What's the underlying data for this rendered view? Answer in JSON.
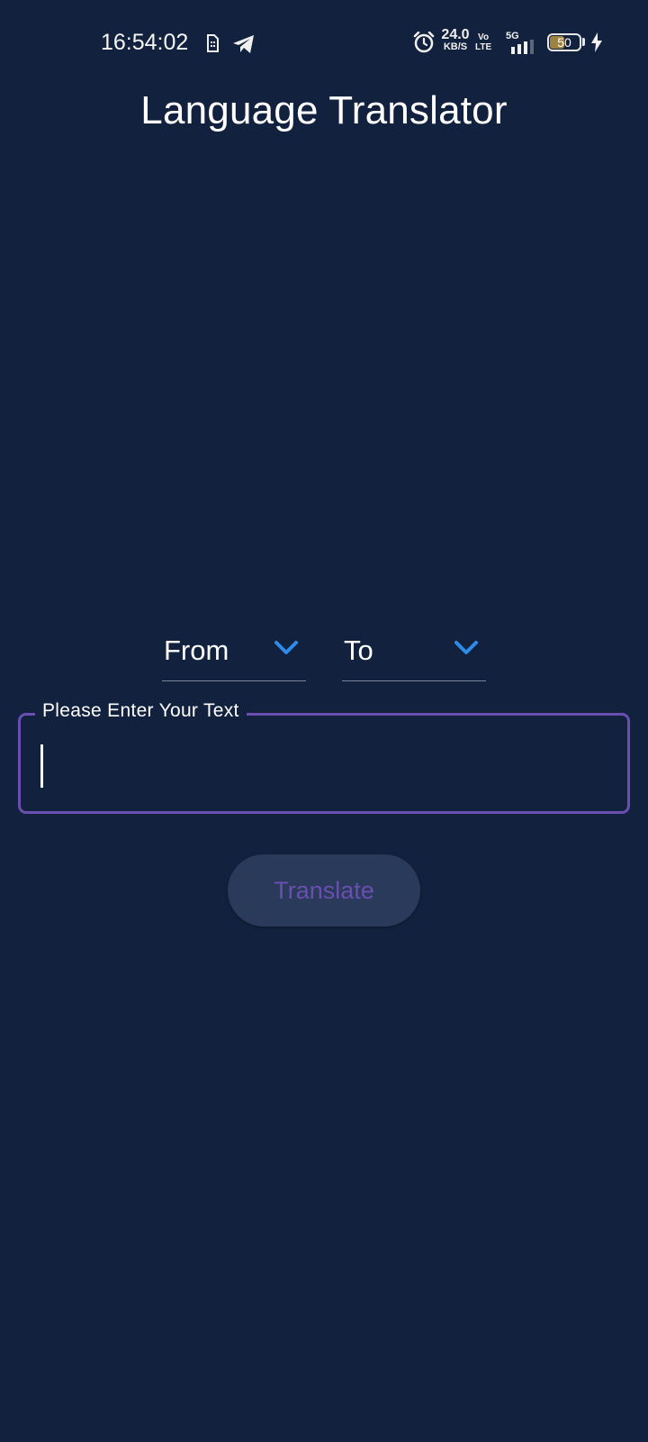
{
  "status_bar": {
    "time": "16:54:02",
    "speed_value": "24.0",
    "speed_unit": "KB/S",
    "volte_top": "Vo",
    "volte_bottom": "LTE",
    "network": "5G",
    "battery_level": "50",
    "battery_fraction": 0.5,
    "icons": [
      "sim-card-icon",
      "telegram-icon",
      "alarm-icon",
      "signal-icon",
      "battery-icon",
      "charging-icon"
    ]
  },
  "app": {
    "title": "Language Translator"
  },
  "dropdowns": {
    "from_label": "From",
    "to_label": "To"
  },
  "input": {
    "label": "Please Enter Your Text",
    "value": ""
  },
  "actions": {
    "translate_label": "Translate"
  },
  "colors": {
    "background": "#12213d",
    "accent": "#6a4fb0",
    "chevron": "#2f8be8",
    "button_bg": "#2a3a5a"
  }
}
